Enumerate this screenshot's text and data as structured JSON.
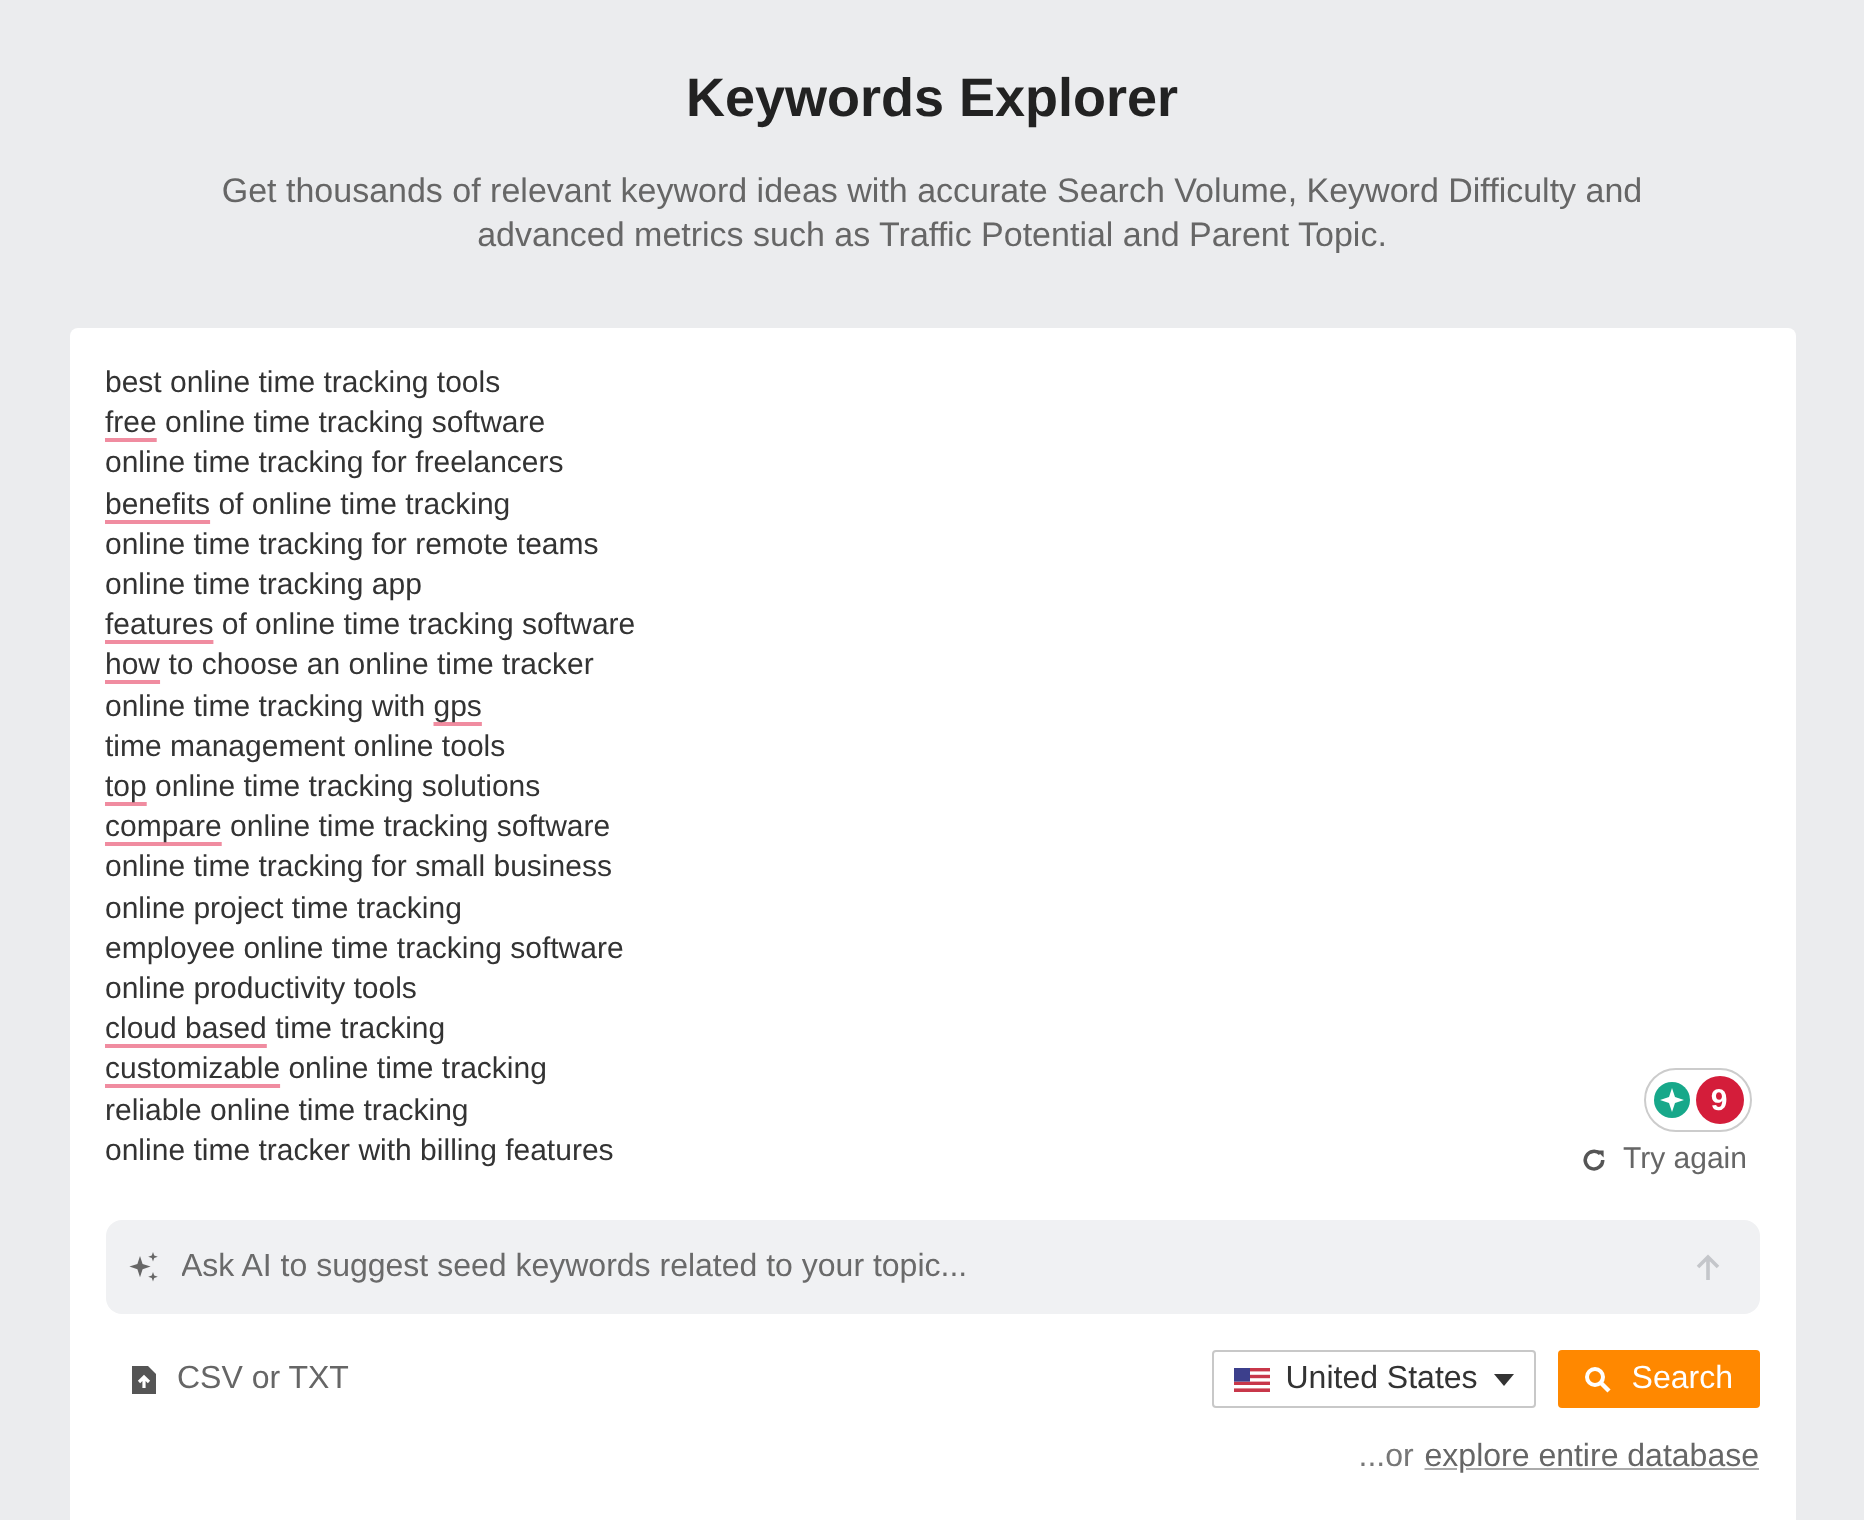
{
  "header": {
    "title": "Keywords Explorer",
    "subtitle": "Get thousands of relevant keyword ideas with accurate Search Volume, Keyword Difficulty and advanced metrics such as Traffic Potential and Parent Topic."
  },
  "keywords": [
    {
      "words": [
        {
          "text": "best online time tracking tools",
          "misspelled": false
        }
      ]
    },
    {
      "words": [
        {
          "text": "free",
          "misspelled": true
        },
        {
          "text": "online time tracking software",
          "misspelled": false
        }
      ]
    },
    {
      "words": [
        {
          "text": "online time tracking for freelancers",
          "misspelled": false
        }
      ]
    },
    {
      "words": [
        {
          "text": "benefits",
          "misspelled": true
        },
        {
          "text": "of online time tracking",
          "misspelled": false
        }
      ]
    },
    {
      "words": [
        {
          "text": "online time tracking for remote teams",
          "misspelled": false
        }
      ]
    },
    {
      "words": [
        {
          "text": "online time tracking app",
          "misspelled": false
        }
      ]
    },
    {
      "words": [
        {
          "text": "features",
          "misspelled": true
        },
        {
          "text": "of online time tracking software",
          "misspelled": false
        }
      ]
    },
    {
      "words": [
        {
          "text": "how",
          "misspelled": true
        },
        {
          "text": "to choose an online time tracker",
          "misspelled": false
        }
      ]
    },
    {
      "words": [
        {
          "text": "online time tracking with",
          "misspelled": false
        },
        {
          "text": "gps",
          "misspelled": true
        }
      ]
    },
    {
      "words": [
        {
          "text": "time management online tools",
          "misspelled": false
        }
      ]
    },
    {
      "words": [
        {
          "text": "top",
          "misspelled": true
        },
        {
          "text": "online time tracking solutions",
          "misspelled": false
        }
      ]
    },
    {
      "words": [
        {
          "text": "compare",
          "misspelled": true
        },
        {
          "text": "online time tracking software",
          "misspelled": false
        }
      ]
    },
    {
      "words": [
        {
          "text": "online time tracking for small business",
          "misspelled": false
        }
      ]
    },
    {
      "words": [
        {
          "text": "online project time tracking",
          "misspelled": false
        }
      ]
    },
    {
      "words": [
        {
          "text": "employee online time tracking software",
          "misspelled": false
        }
      ]
    },
    {
      "words": [
        {
          "text": "online productivity tools",
          "misspelled": false
        }
      ]
    },
    {
      "words": [
        {
          "text": "cloud based",
          "misspelled": true
        },
        {
          "text": "time tracking",
          "misspelled": false
        }
      ]
    },
    {
      "words": [
        {
          "text": "customizable",
          "misspelled": true
        },
        {
          "text": "online time tracking",
          "misspelled": false
        }
      ]
    },
    {
      "words": [
        {
          "text": "reliable online time tracking",
          "misspelled": false
        }
      ]
    },
    {
      "words": [
        {
          "text": "online time tracker with billing features",
          "misspelled": false
        }
      ]
    }
  ],
  "try_again": {
    "label": "Try again"
  },
  "extension_badge": {
    "count": "9"
  },
  "ai_prompt": {
    "placeholder": "Ask AI to suggest seed keywords related to your topic..."
  },
  "upload": {
    "label": "CSV or TXT"
  },
  "country": {
    "label": "United States"
  },
  "search_button": {
    "label": "Search"
  },
  "explore": {
    "prefix": "...or",
    "link": "explore entire database"
  }
}
